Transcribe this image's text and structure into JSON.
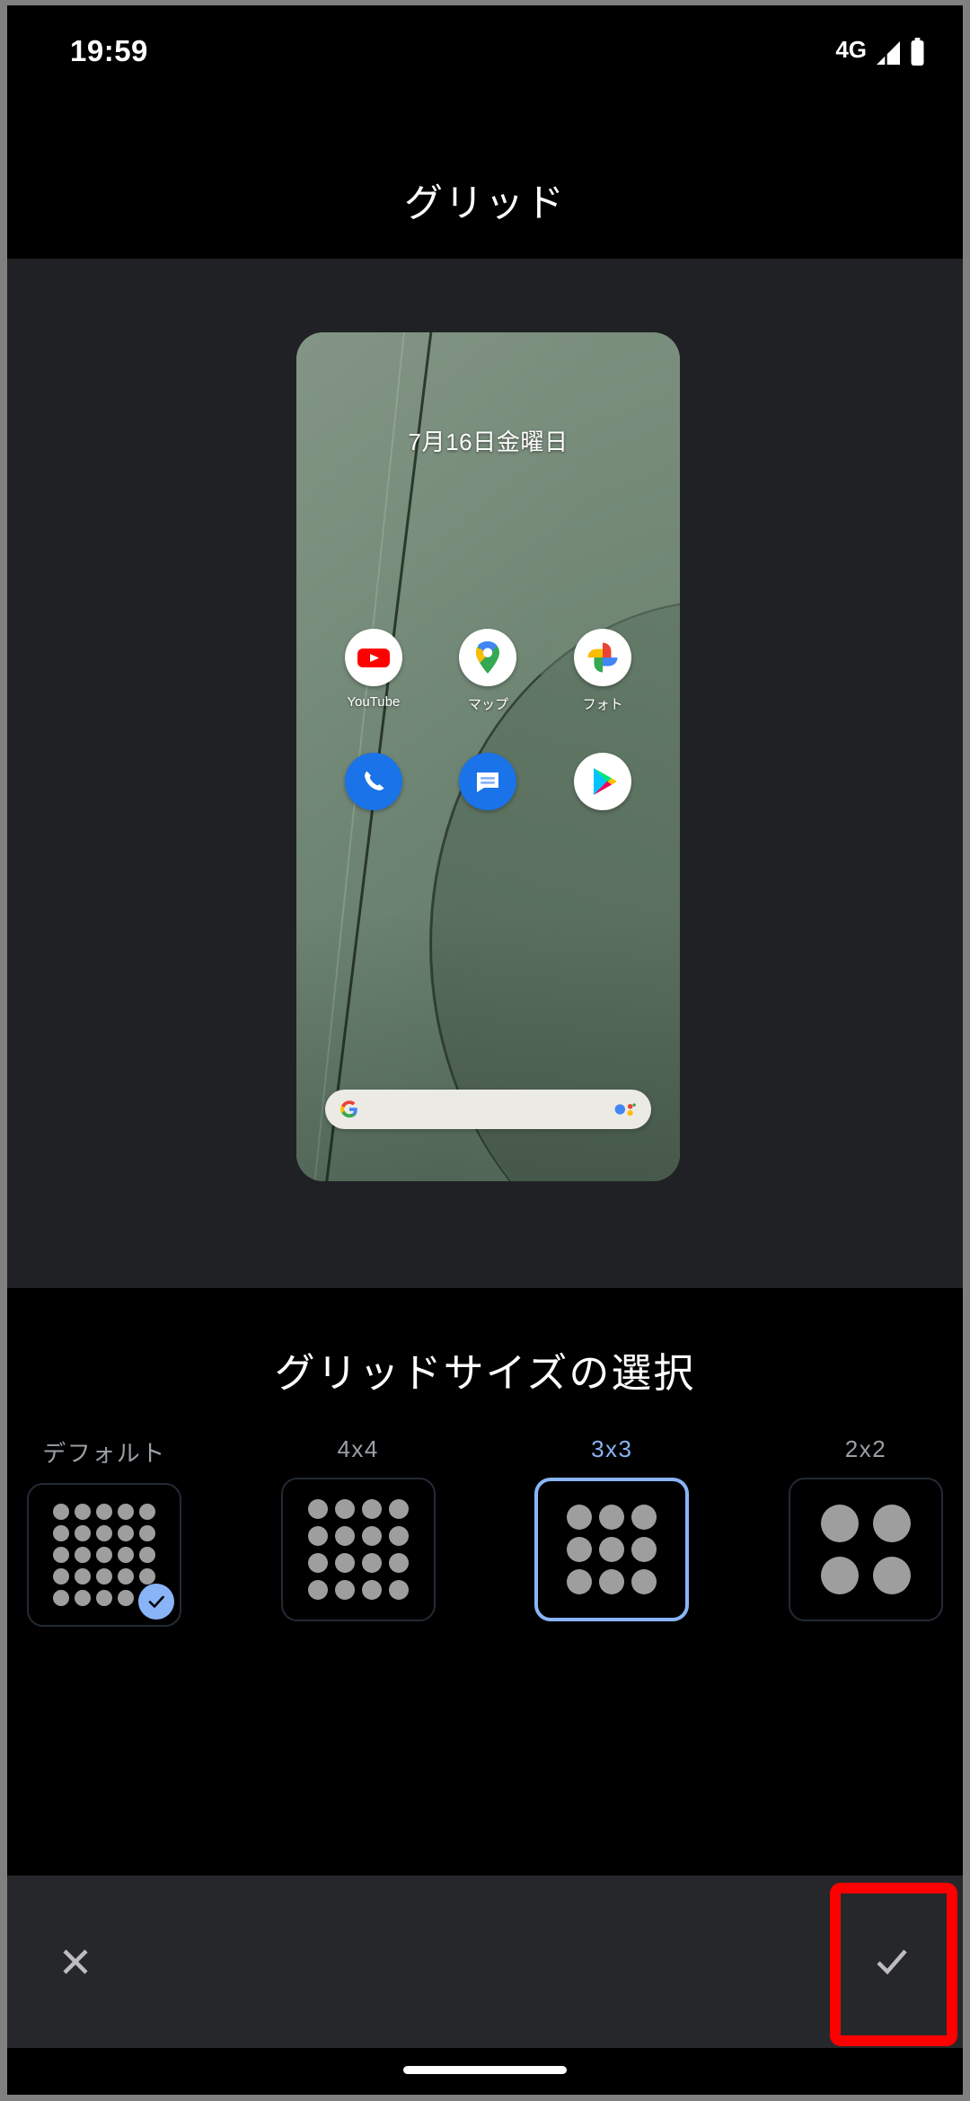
{
  "status_bar": {
    "time": "19:59",
    "network_label": "4G",
    "signal_icon": "signal-bars-icon",
    "battery_icon": "battery-full-icon"
  },
  "header": {
    "title": "グリッド"
  },
  "preview": {
    "date_text": "7月16日金曜日",
    "wallpaper_color": "#6d8470",
    "app_rows": [
      [
        {
          "name": "youtube",
          "label": "YouTube",
          "icon": "youtube-icon"
        },
        {
          "name": "maps",
          "label": "マップ",
          "icon": "google-maps-icon"
        },
        {
          "name": "photos",
          "label": "フォト",
          "icon": "google-photos-icon"
        }
      ],
      [
        {
          "name": "phone",
          "label": "",
          "icon": "phone-icon"
        },
        {
          "name": "messages",
          "label": "",
          "icon": "messages-icon"
        },
        {
          "name": "play-store",
          "label": "",
          "icon": "play-store-icon"
        }
      ]
    ],
    "search_bar": {
      "left_icon": "google-g-icon",
      "right_icon": "google-assistant-icon",
      "value": "",
      "placeholder": ""
    }
  },
  "picker": {
    "title": "グリッドサイズの選択",
    "accent_color": "#8ab4f8",
    "dot_color": "#9e9e9e",
    "options": [
      {
        "label": "デフォルト",
        "columns": 5,
        "rows": 5,
        "dot_size": 18,
        "selected": false,
        "applied": true
      },
      {
        "label": "4x4",
        "columns": 4,
        "rows": 4,
        "dot_size": 22,
        "selected": false,
        "applied": false
      },
      {
        "label": "3x3",
        "columns": 3,
        "rows": 3,
        "dot_size": 28,
        "selected": true,
        "applied": false
      },
      {
        "label": "2x2",
        "columns": 2,
        "rows": 2,
        "dot_size": 42,
        "selected": false,
        "applied": false
      }
    ]
  },
  "action_bar": {
    "cancel_icon": "close-icon",
    "confirm_icon": "check-icon",
    "annotation_color": "#ff0000",
    "annotation_target": "confirm-button"
  },
  "nav_bar": {
    "gesture_pill": "home-gesture-pill"
  }
}
